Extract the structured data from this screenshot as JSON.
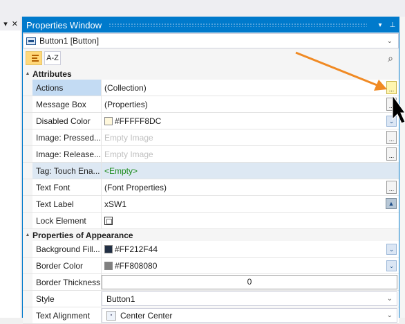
{
  "left_panel": {
    "pin_glyph": "▾",
    "close_glyph": "✕"
  },
  "window": {
    "title": "Properties Window",
    "dropdown_glyph": "▾",
    "pin_glyph": "⊥"
  },
  "object_selector": {
    "value": "Button1 [Button]",
    "chevron": "⌄"
  },
  "toolbar": {
    "sort_az_label": "A-Z",
    "search_glyph": "⌕"
  },
  "categories": [
    {
      "name": "Attributes",
      "rows": [
        {
          "name": "Actions",
          "value": "(Collection)",
          "editor": "ellipsis-hot",
          "selected": true
        },
        {
          "name": "Message Box",
          "value": "(Properties)",
          "editor": "ellipsis"
        },
        {
          "name": "Disabled Color",
          "value": "#FFFFF8DC",
          "editor": "dropdown",
          "swatch": "#FFF8DC"
        },
        {
          "name": "Image: Pressed...",
          "value": "Empty Image",
          "editor": "ellipsis",
          "placeholder": true
        },
        {
          "name": "Image: Release...",
          "value": "Empty Image",
          "editor": "ellipsis",
          "placeholder": true
        },
        {
          "name": "Tag: Touch Ena...",
          "value": "<Empty>",
          "editor": "none",
          "green": true,
          "highlight": true
        },
        {
          "name": "Text Font",
          "value": "(Font Properties)",
          "editor": "ellipsis"
        },
        {
          "name": "Text Label",
          "value": "xSW1",
          "editor": "image"
        },
        {
          "name": "Lock Element",
          "value": "",
          "editor": "checkbox"
        }
      ]
    },
    {
      "name": "Properties of Appearance",
      "rows": [
        {
          "name": "Background Fill...",
          "value": "#FF212F44",
          "editor": "dropdown",
          "swatch": "#212F44"
        },
        {
          "name": "Border Color",
          "value": "#FF808080",
          "editor": "dropdown",
          "swatch": "#808080"
        },
        {
          "name": "Border Thickness",
          "value": "0",
          "editor": "number"
        },
        {
          "name": "Style",
          "value": "Button1",
          "editor": "combo"
        },
        {
          "name": "Text Alignment",
          "value": "Center Center",
          "editor": "combo-icon"
        }
      ]
    }
  ],
  "ellipsis_label": "...",
  "colors": {
    "accent": "#007acc",
    "annotation_arrow": "#f08a24",
    "selected_row": "#c3dbf3"
  }
}
